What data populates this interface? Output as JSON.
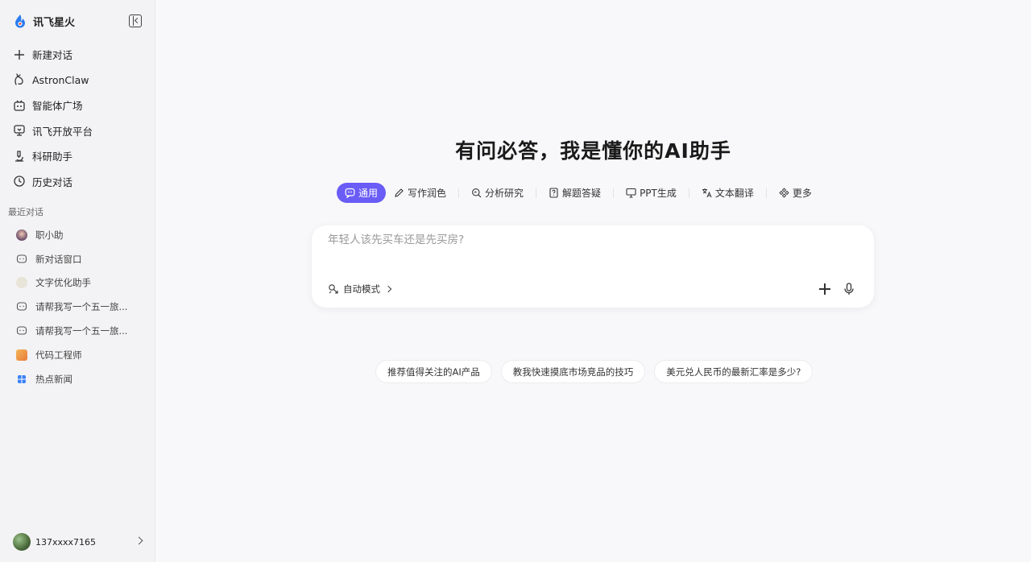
{
  "brand": {
    "name": "讯飞星火"
  },
  "nav": [
    {
      "label": "新建对话",
      "icon": "plus-icon"
    },
    {
      "label": "AstronClaw",
      "icon": "claw-icon"
    },
    {
      "label": "智能体广场",
      "icon": "robot-icon"
    },
    {
      "label": "讯飞开放平台",
      "icon": "platform-icon"
    },
    {
      "label": "科研助手",
      "icon": "microscope-icon"
    },
    {
      "label": "历史对话",
      "icon": "history-icon"
    }
  ],
  "recent": {
    "label": "最近对话",
    "items": [
      {
        "label": "职小助",
        "icon": "avatar-icon"
      },
      {
        "label": "新对话窗口",
        "icon": "chat-bubble-icon"
      },
      {
        "label": "文字优化助手",
        "icon": "avatar-icon"
      },
      {
        "label": "请帮我写一个五一旅...",
        "icon": "chat-bubble-icon"
      },
      {
        "label": "请帮我写一个五一旅...",
        "icon": "chat-bubble-icon"
      },
      {
        "label": "代码工程师",
        "icon": "avatar-icon"
      },
      {
        "label": "热点新闻",
        "icon": "grid-icon"
      }
    ]
  },
  "user": {
    "name": "137xxxx7165"
  },
  "main": {
    "headline": "有问必答，我是懂你的AI助手",
    "tabs": [
      {
        "label": "通用",
        "icon": "chat-icon",
        "active": true
      },
      {
        "label": "写作润色",
        "icon": "pen-icon"
      },
      {
        "label": "分析研究",
        "icon": "search-analysis-icon"
      },
      {
        "label": "解题答疑",
        "icon": "question-icon"
      },
      {
        "label": "PPT生成",
        "icon": "presentation-icon"
      },
      {
        "label": "文本翻译",
        "icon": "translate-icon"
      },
      {
        "label": "更多",
        "icon": "more-icon"
      }
    ],
    "composer": {
      "placeholder": "年轻人该先买车还是先买房?",
      "mode_label": "自动模式"
    },
    "suggestions": [
      "推荐值得关注的AI产品",
      "教我快速摸底市场竞品的技巧",
      "美元兑人民币的最新汇率是多少?"
    ]
  },
  "colors": {
    "accent": "#6a5cf6"
  }
}
